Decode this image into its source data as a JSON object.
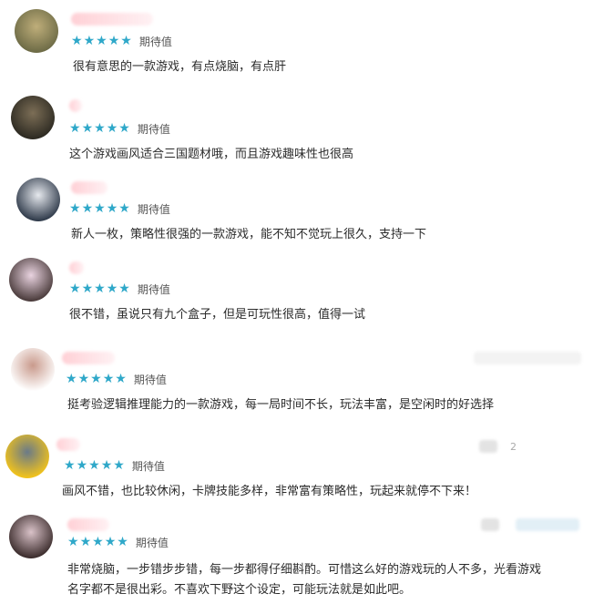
{
  "reviews": [
    {
      "rating": 5,
      "status": "期待值",
      "lines": [
        "很有意思的一款游戏，有点烧脑，有点肝"
      ],
      "avatar_colors": [
        "#6d6b46",
        "#bfae7a"
      ]
    },
    {
      "rating": 5,
      "status": "期待值",
      "lines": [
        "这个游戏画风适合三国题材哦，而且游戏趣味性也很高"
      ],
      "avatar_colors": [
        "#2d2a22",
        "#7c6e56"
      ]
    },
    {
      "rating": 5,
      "status": "期待值",
      "lines": [
        "新人一枚，策略性很强的一款游戏，能不知不觉玩上很久，支持一下"
      ],
      "avatar_colors": [
        "#2f3a4a",
        "#e6e9ee"
      ]
    },
    {
      "rating": 5,
      "status": "期待值",
      "lines": [
        "很不错，虽说只有九个盒子，但是可玩性很高，值得一试"
      ],
      "avatar_colors": [
        "#4a3b3b",
        "#e9d3e0"
      ]
    },
    {
      "rating": 5,
      "status": "期待值",
      "lines": [
        "挺考验逻辑推理能力的一款游戏，每一局时间不长，玩法丰富，是空闲时的好选择"
      ],
      "avatar_colors": [
        "#ffffff",
        "#c99a8c"
      ]
    },
    {
      "rating": 5,
      "status": "期待值",
      "lines": [
        "画风不错，也比较休闲，卡牌技能多样，非常富有策略性，玩起来就停不下来！"
      ],
      "avatar_colors": [
        "#f2c31b",
        "#6a7a88"
      ],
      "side_number": "2"
    },
    {
      "rating": 5,
      "status": "期待值",
      "lines": [
        "非常烧脑，一步错步步错，每一步都得仔细斟酌。可惜这么好的游戏玩的人不多，光看游戏",
        "名字都不是很出彩。不喜欢下野这个设定，可能玩法就是如此吧。"
      ],
      "avatar_colors": [
        "#3b2c2c",
        "#d9c2c8"
      ]
    }
  ]
}
